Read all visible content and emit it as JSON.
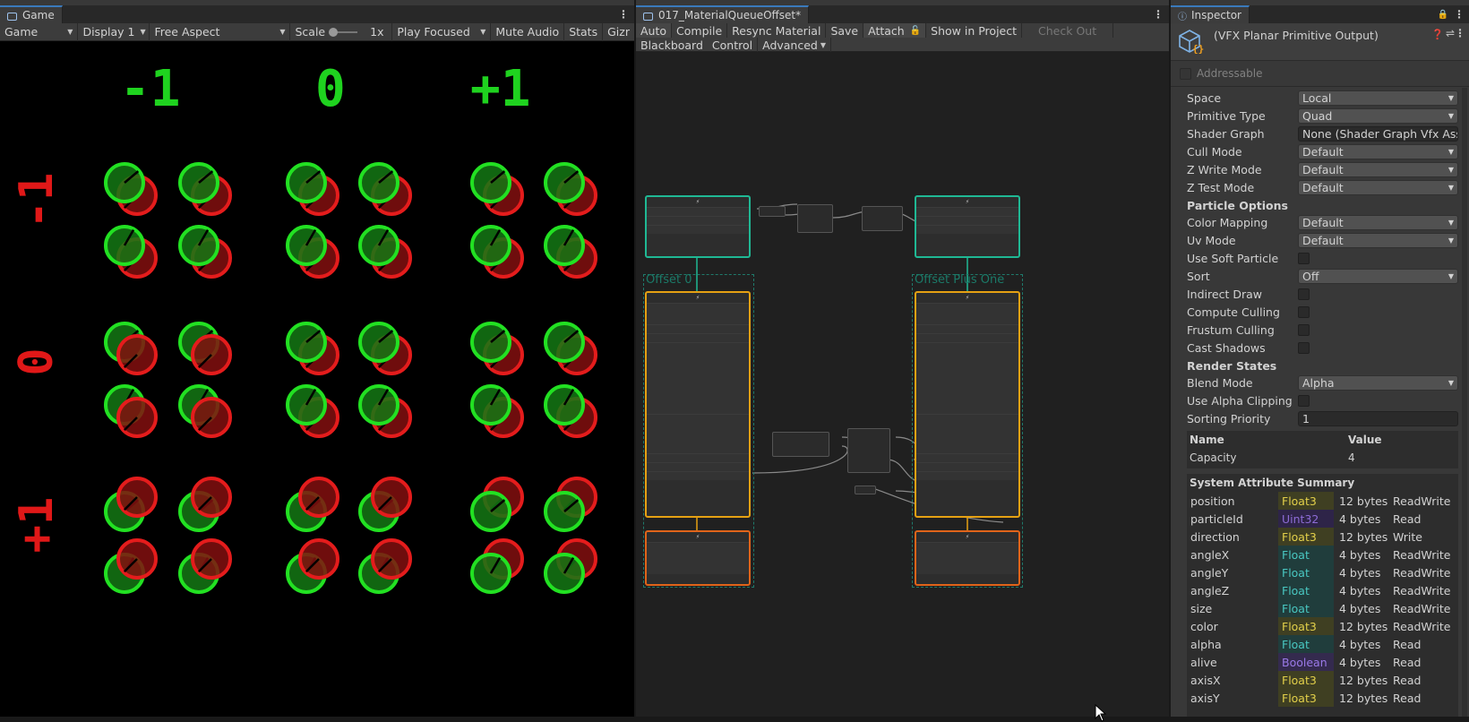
{
  "game": {
    "tab_label": "Game",
    "toolbar": {
      "view_mode": "Game",
      "display": "Display 1",
      "aspect": "Free Aspect",
      "scale_label": "Scale",
      "scale_value": "1x",
      "play_mode": "Play Focused",
      "mute": "Mute Audio",
      "stats": "Stats",
      "gizmos": "Gizr"
    },
    "column_labels": [
      "-1",
      "0",
      "+1"
    ],
    "row_labels": [
      "-1",
      "0",
      "+1"
    ]
  },
  "vfx": {
    "tab_label": "017_MaterialQueueOffset*",
    "toolbar": {
      "auto": "Auto",
      "compile": "Compile",
      "resync": "Resync Material",
      "save": "Save",
      "attach": "Attach",
      "show_in_project": "Show in Project",
      "check_out": "Check Out",
      "blackboard": "Blackboard",
      "control": "Control",
      "advanced": "Advanced"
    },
    "groups": {
      "left": "Offset 0",
      "right": "Offset Plus One"
    }
  },
  "inspector": {
    "tab_label": "Inspector",
    "title": "(VFX Planar Primitive Output)",
    "addressable": "Addressable",
    "properties": [
      {
        "label": "Space",
        "value": "Local",
        "kind": "dropdown"
      },
      {
        "label": "Primitive Type",
        "value": "Quad",
        "kind": "dropdown"
      },
      {
        "label": "Shader Graph",
        "value": "None (Shader Graph Vfx Asse",
        "kind": "object"
      },
      {
        "label": "Cull Mode",
        "value": "Default",
        "kind": "dropdown"
      },
      {
        "label": "Z Write Mode",
        "value": "Default",
        "kind": "dropdown"
      },
      {
        "label": "Z Test Mode",
        "value": "Default",
        "kind": "dropdown"
      }
    ],
    "particle_options_header": "Particle Options",
    "particle_options": [
      {
        "label": "Color Mapping",
        "value": "Default",
        "kind": "dropdown"
      },
      {
        "label": "Uv Mode",
        "value": "Default",
        "kind": "dropdown"
      },
      {
        "label": "Use Soft Particle",
        "value": "",
        "kind": "checkbox"
      },
      {
        "label": "Sort",
        "value": "Off",
        "kind": "dropdown"
      },
      {
        "label": "Indirect Draw",
        "value": "",
        "kind": "checkbox"
      },
      {
        "label": "Compute Culling",
        "value": "",
        "kind": "checkbox"
      },
      {
        "label": "Frustum Culling",
        "value": "",
        "kind": "checkbox"
      },
      {
        "label": "Cast Shadows",
        "value": "",
        "kind": "checkbox"
      }
    ],
    "render_states_header": "Render States",
    "render_states": [
      {
        "label": "Blend Mode",
        "value": "Alpha",
        "kind": "dropdown"
      },
      {
        "label": "Use Alpha Clipping",
        "value": "",
        "kind": "checkbox"
      },
      {
        "label": "Sorting Priority",
        "value": "1",
        "kind": "text"
      }
    ],
    "name_header": "Name",
    "value_header": "Value",
    "capacity_label": "Capacity",
    "capacity_value": "4",
    "summary_header": "System Attribute Summary",
    "attributes": [
      {
        "name": "position",
        "type": "Float3",
        "size": "12 bytes",
        "access": "ReadWrite"
      },
      {
        "name": "particleId",
        "type": "Uint32",
        "size": "4 bytes",
        "access": "Read"
      },
      {
        "name": "direction",
        "type": "Float3",
        "size": "12 bytes",
        "access": "Write"
      },
      {
        "name": "angleX",
        "type": "Float",
        "size": "4 bytes",
        "access": "ReadWrite"
      },
      {
        "name": "angleY",
        "type": "Float",
        "size": "4 bytes",
        "access": "ReadWrite"
      },
      {
        "name": "angleZ",
        "type": "Float",
        "size": "4 bytes",
        "access": "ReadWrite"
      },
      {
        "name": "size",
        "type": "Float",
        "size": "4 bytes",
        "access": "ReadWrite"
      },
      {
        "name": "color",
        "type": "Float3",
        "size": "12 bytes",
        "access": "ReadWrite"
      },
      {
        "name": "alpha",
        "type": "Float",
        "size": "4 bytes",
        "access": "Read"
      },
      {
        "name": "alive",
        "type": "Boolean",
        "size": "4 bytes",
        "access": "Read"
      },
      {
        "name": "axisX",
        "type": "Float3",
        "size": "12 bytes",
        "access": "Read"
      },
      {
        "name": "axisY",
        "type": "Float3",
        "size": "12 bytes",
        "access": "Read"
      }
    ]
  }
}
